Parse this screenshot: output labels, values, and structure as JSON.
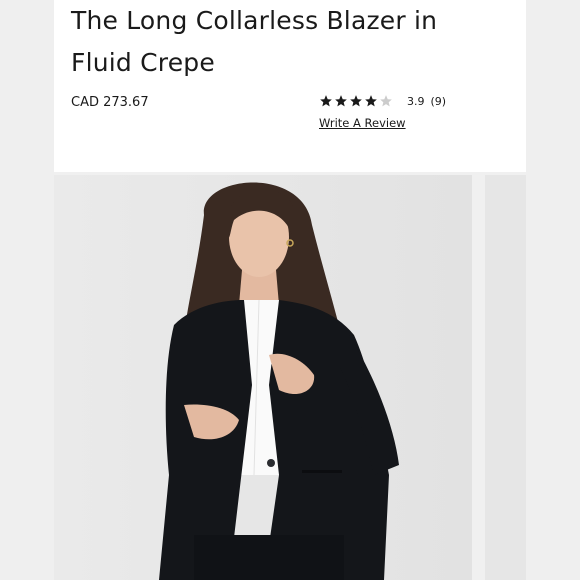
{
  "product": {
    "title_line1": "The Long Collarless Blazer in",
    "title_line2": "Fluid Crepe",
    "price": "CAD 273.67"
  },
  "rating": {
    "value": "3.9",
    "count": "(9)",
    "stars_filled": 4,
    "stars_total": 5,
    "write_review_label": "Write A Review"
  },
  "gallery": {
    "main_image_icon": "model-wearing-black-blazer-photo",
    "next_image_icon": "next-product-photo-peek"
  },
  "colors": {
    "background": "#f0f0f0",
    "card": "#ffffff",
    "text": "#1a1a1a",
    "star_filled": "#1a1a1a",
    "star_empty": "#cccccc",
    "blazer": "#14161a"
  }
}
